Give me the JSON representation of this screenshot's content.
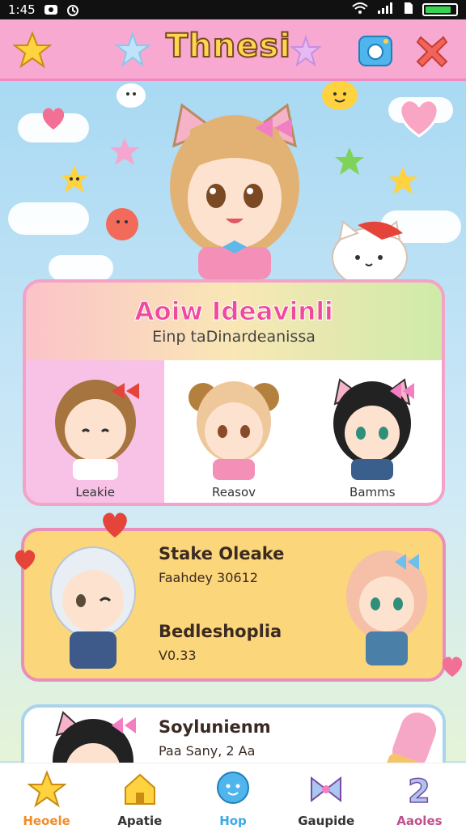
{
  "status_bar": {
    "time": "1:45"
  },
  "header": {
    "title": "Thnesi"
  },
  "featured": {
    "title": "Aoiw Ideavinli",
    "subtitle": "Einp taDinardeanissa",
    "characters": [
      {
        "name": "Leakie"
      },
      {
        "name": "Reasov"
      },
      {
        "name": "Bamms"
      }
    ]
  },
  "story": {
    "title": "Stake Oleake",
    "subtitle": "Faahdey 30612",
    "title2": "Bedleshoplia",
    "subtitle2": "V0.33"
  },
  "third": {
    "title": "Soylunienm",
    "subtitle": "Paa Sany, 2 Aa"
  },
  "bottom_nav": [
    {
      "label": "Heoele",
      "color": "#f28c28",
      "icon": "star-icon"
    },
    {
      "label": "Apatie",
      "color": "#333333",
      "icon": "house-icon"
    },
    {
      "label": "Hop",
      "color": "#3aa9e6",
      "icon": "chat-bubble-icon"
    },
    {
      "label": "Gaupide",
      "color": "#333333",
      "icon": "bow-icon"
    },
    {
      "label": "Aaoles",
      "color": "#c0508f",
      "icon": "number-two-icon"
    }
  ],
  "colors": {
    "header": "#f7a9d1",
    "accent_pink": "#ef4a9d",
    "battery": "#39d353"
  },
  "battery_level": 0.85
}
